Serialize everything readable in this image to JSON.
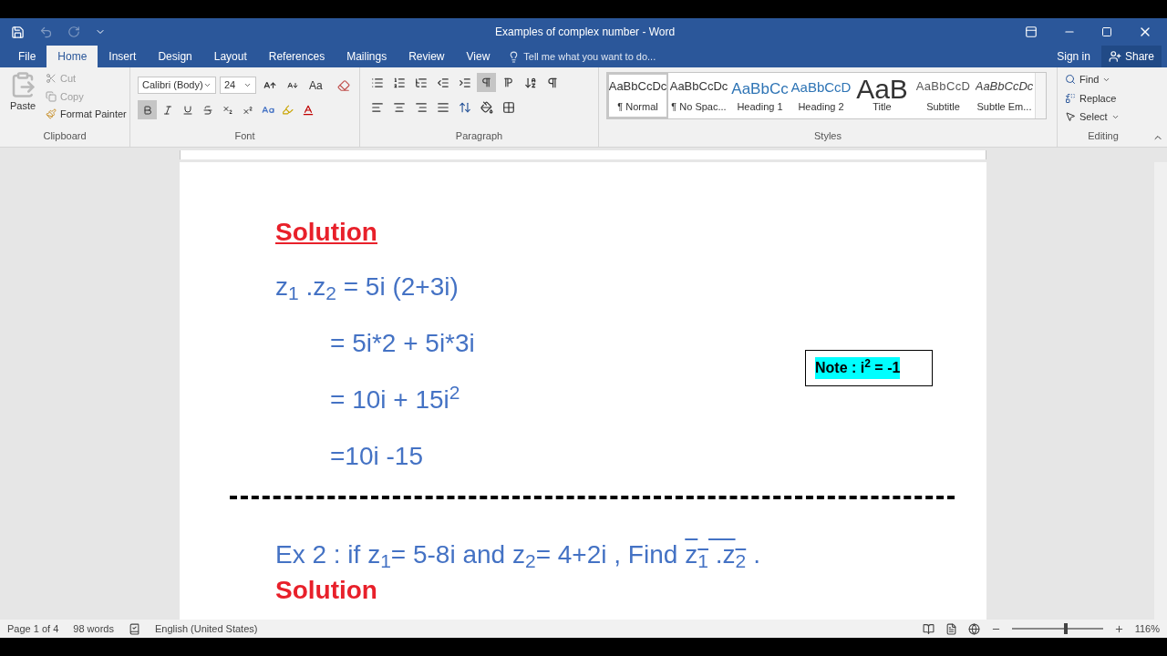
{
  "window": {
    "title": "Examples of complex number - Word"
  },
  "tabs": [
    {
      "label": "File",
      "selected": false
    },
    {
      "label": "Home",
      "selected": true
    },
    {
      "label": "Insert",
      "selected": false
    },
    {
      "label": "Design",
      "selected": false
    },
    {
      "label": "Layout",
      "selected": false
    },
    {
      "label": "References",
      "selected": false
    },
    {
      "label": "Mailings",
      "selected": false
    },
    {
      "label": "Review",
      "selected": false
    },
    {
      "label": "View",
      "selected": false
    }
  ],
  "tell_me": {
    "placeholder": "Tell me what you want to do..."
  },
  "account": {
    "sign_in": "Sign in",
    "share": "Share"
  },
  "clipboard": {
    "paste": "Paste",
    "cut": "Cut",
    "copy": "Copy",
    "format_painter": "Format Painter",
    "group": "Clipboard"
  },
  "font": {
    "name": "Calibri (Body)",
    "size": "24",
    "case_label": "Aa",
    "group": "Font",
    "bold": true,
    "italic": false,
    "underline": false
  },
  "paragraph": {
    "group": "Paragraph",
    "ltr": true
  },
  "styles": {
    "group": "Styles",
    "items": [
      {
        "preview": "AaBbCcDc",
        "label": "¶ Normal",
        "kind": "normal",
        "selected": true
      },
      {
        "preview": "AaBbCcDc",
        "label": "¶ No Spac...",
        "kind": "normal",
        "selected": false
      },
      {
        "preview": "AaBbCc",
        "label": "Heading 1",
        "kind": "heading1",
        "selected": false
      },
      {
        "preview": "AaBbCcD",
        "label": "Heading 2",
        "kind": "heading2",
        "selected": false
      },
      {
        "preview": "AaB",
        "label": "Title",
        "kind": "title",
        "selected": false
      },
      {
        "preview": "AaBbCcD",
        "label": "Subtitle",
        "kind": "subtitle",
        "selected": false
      },
      {
        "preview": "AaBbCcDc",
        "label": "Subtle Em...",
        "kind": "emphasis",
        "selected": false
      }
    ]
  },
  "editing": {
    "group": "Editing",
    "find": "Find",
    "replace": "Replace",
    "select": "Select"
  },
  "document": {
    "heading": "Solution",
    "lines": [
      {
        "text": "z$_{1}$ .z$_{2}$ = 5i (2+3i)",
        "indent": false
      },
      {
        "text": "= 5i*2 + 5i*3i",
        "indent": true
      },
      {
        "text": "= 10i + 15i$^{2}$",
        "indent": true
      },
      {
        "text": "=10i -15",
        "indent": true
      }
    ],
    "note": "Note : i$^{2}$ = -1",
    "exercise": "Ex 2 : if z$_{1}$= 5-8i and z$_{2}$= 4+2i  , Find",
    "find_target": "z$_{1}$ .z$_{2}$",
    "exercise_end": ".",
    "next_heading": "Solution"
  },
  "status_bar": {
    "page": "Page 1 of 4",
    "words": "98 words",
    "language": "English (United States)",
    "zoom": "116%",
    "level": 0.6
  }
}
